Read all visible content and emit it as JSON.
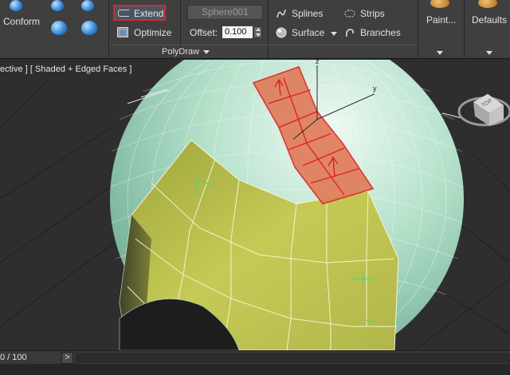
{
  "ribbon": {
    "conform_label": "Conform",
    "extend_label": "Extend",
    "optimize_label": "Optimize",
    "object_name": "Sphere001",
    "offset_label": "Offset:",
    "offset_value": "0.100",
    "splines_label": "Splines",
    "surface_label": "Surface",
    "strips_label": "Strips",
    "branches_label": "Branches",
    "paint_label": "Paint...",
    "defaults_label": "Defaults",
    "group_title": "PolyDraw"
  },
  "viewport": {
    "label": "ective ] [ Shaded + Edged Faces ]",
    "axis_z": "z",
    "axis_y": "y",
    "cube_face": "TOP"
  },
  "timebar": {
    "frame_label": "0 / 100",
    "next_label": ">"
  },
  "colors": {
    "selection": "#e07a58",
    "selection_edge": "#e02020",
    "mesh": "#c7cc4e",
    "sphere": "#a9dcc4",
    "ribbon": "#3f3f3f"
  }
}
